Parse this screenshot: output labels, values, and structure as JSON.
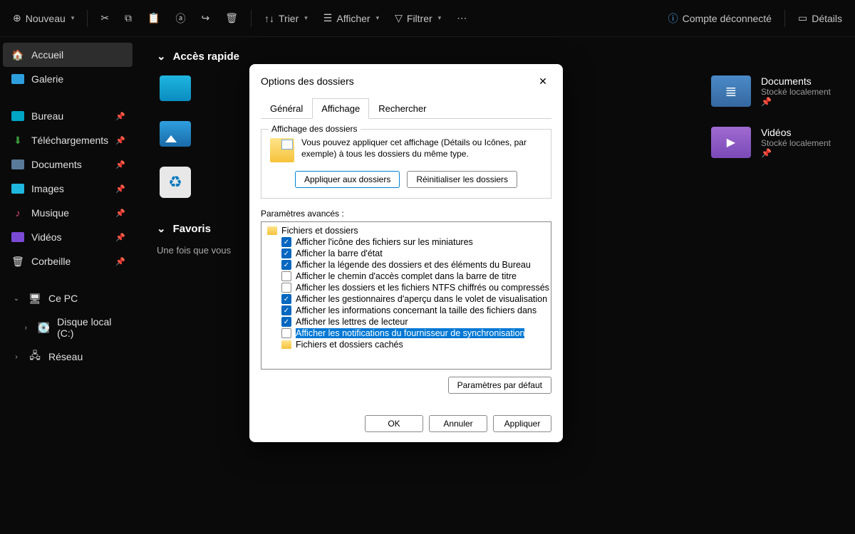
{
  "toolbar": {
    "new": "Nouveau",
    "sort": "Trier",
    "view": "Afficher",
    "filter": "Filtrer",
    "account": "Compte déconnecté",
    "details": "Détails"
  },
  "sidebar": {
    "home": "Accueil",
    "gallery": "Galerie",
    "desktop": "Bureau",
    "downloads": "Téléchargements",
    "documents": "Documents",
    "pictures": "Images",
    "music": "Musique",
    "videos": "Vidéos",
    "recycle": "Corbeille",
    "thispc": "Ce PC",
    "disk": "Disque local (C:)",
    "network": "Réseau"
  },
  "main": {
    "quick_access": "Accès rapide",
    "favorites": "Favoris",
    "fav_hint": "Une fois que vous",
    "documents": {
      "name": "Documents",
      "sub": "Stocké localement"
    },
    "videos": {
      "name": "Vidéos",
      "sub": "Stocké localement"
    }
  },
  "dialog": {
    "title": "Options des dossiers",
    "tabs": {
      "general": "Général",
      "view": "Affichage",
      "search": "Rechercher"
    },
    "group_title": "Affichage des dossiers",
    "group_text": "Vous pouvez appliquer cet affichage (Détails ou Icônes, par exemple) à tous les dossiers du même type.",
    "apply_folders": "Appliquer aux dossiers",
    "reset_folders": "Réinitialiser les dossiers",
    "advanced_label": "Paramètres avancés :",
    "tree": {
      "root": "Fichiers et dossiers",
      "items": [
        {
          "checked": true,
          "label": "Afficher l'icône des fichiers sur les miniatures"
        },
        {
          "checked": true,
          "label": "Afficher la barre d'état"
        },
        {
          "checked": true,
          "label": "Afficher la légende des dossiers et des éléments du Bureau"
        },
        {
          "checked": false,
          "label": "Afficher le chemin d'accès complet dans la barre de titre"
        },
        {
          "checked": false,
          "label": "Afficher les dossiers et les fichiers NTFS chiffrés ou compressés"
        },
        {
          "checked": true,
          "label": "Afficher les gestionnaires d'aperçu dans le volet de visualisation"
        },
        {
          "checked": true,
          "label": "Afficher les informations concernant la taille des fichiers dans"
        },
        {
          "checked": true,
          "label": "Afficher les lettres de lecteur"
        },
        {
          "checked": false,
          "label": "Afficher les notifications du fournisseur de synchronisation",
          "selected": true
        }
      ],
      "hidden_root": "Fichiers et dossiers cachés"
    },
    "restore": "Paramètres par défaut",
    "ok": "OK",
    "cancel": "Annuler",
    "apply": "Appliquer"
  }
}
